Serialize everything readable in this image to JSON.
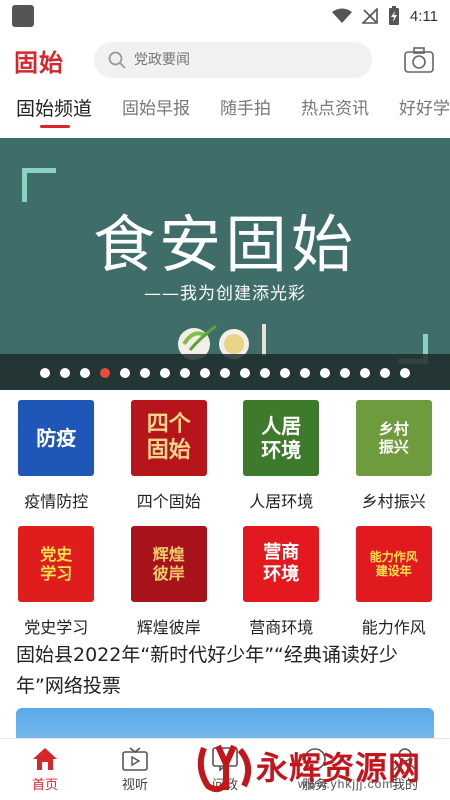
{
  "status_bar": {
    "time": "4:11"
  },
  "header": {
    "logo": "固始",
    "search": {
      "placeholder": "党政要闻"
    }
  },
  "tabs": [
    {
      "label": "固始频道",
      "active": true
    },
    {
      "label": "固始早报",
      "active": false
    },
    {
      "label": "随手拍",
      "active": false
    },
    {
      "label": "热点资讯",
      "active": false
    },
    {
      "label": "好好学",
      "active": false
    }
  ],
  "banner": {
    "title": "食安固始",
    "subtitle": "——我为创建添光彩",
    "dot_count": 19,
    "active_dot": 3
  },
  "grid": [
    {
      "label": "疫情防控",
      "tile_text": "防疫",
      "icon": "epidemic-prevention-icon",
      "bg": "#1f57b8",
      "color": "#ffffff",
      "size": 20
    },
    {
      "label": "四个固始",
      "tile_text": "四个\n固始",
      "icon": "four-gushi-icon",
      "bg": "#b5151b",
      "color": "#f5d58a",
      "size": 22
    },
    {
      "label": "人居环境",
      "tile_text": "人居\n环境",
      "icon": "living-environment-icon",
      "bg": "#3d7a2c",
      "color": "#ffffff",
      "size": 20
    },
    {
      "label": "乡村振兴",
      "tile_text": "乡村\n振兴",
      "icon": "rural-revitalization-icon",
      "bg": "#6f9b3f",
      "color": "#ffffff",
      "size": 15
    },
    {
      "label": "党史学习",
      "tile_text": "党史\n学习",
      "icon": "party-history-icon",
      "bg": "#e01d1d",
      "color": "#ffe34d",
      "size": 16
    },
    {
      "label": "辉煌彼岸",
      "tile_text": "辉煌\n彼岸",
      "icon": "glorious-shore-icon",
      "bg": "#a8121a",
      "color": "#f1c96a",
      "size": 16
    },
    {
      "label": "营商环境",
      "tile_text": "营商\n环境",
      "icon": "business-environment-icon",
      "bg": "#e4181f",
      "color": "#ffffff",
      "size": 18
    },
    {
      "label": "能力作风",
      "tile_text": "能力作风\n建设年",
      "icon": "ability-style-icon",
      "bg": "#e01a1f",
      "color": "#ffe34d",
      "size": 12
    }
  ],
  "article": {
    "title": "固始县2022年“新时代好少年”“经典诵读好少年”网络投票"
  },
  "bottom_nav": [
    {
      "label": "首页",
      "icon": "home-icon",
      "active": true
    },
    {
      "label": "视听",
      "icon": "tv-icon",
      "active": false
    },
    {
      "label": "问政",
      "icon": "question-icon",
      "active": false
    },
    {
      "label": "服务",
      "icon": "service-icon",
      "active": false
    },
    {
      "label": "我的",
      "icon": "profile-icon",
      "active": false
    }
  ],
  "watermark": {
    "text": "永辉资源网",
    "url": "www.yhkjjj.com"
  },
  "colors": {
    "accent": "#d9262c",
    "banner_bg": "#3f6e6a"
  }
}
